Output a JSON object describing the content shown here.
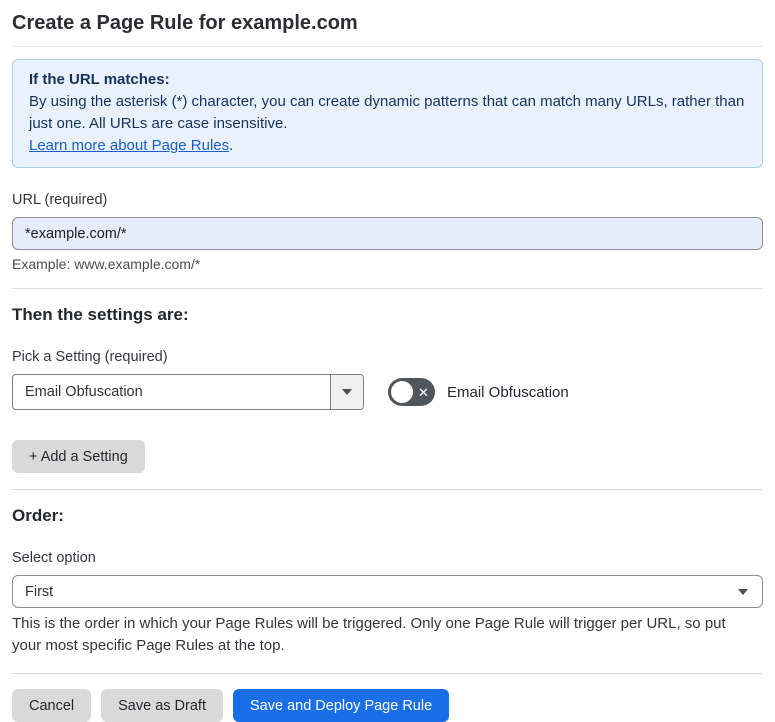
{
  "page": {
    "title": "Create a Page Rule for example.com"
  },
  "callout": {
    "heading": "If the URL matches:",
    "body": "By using the asterisk (*) character, you can create dynamic patterns that can match many URLs, rather than just one. All URLs are case insensitive.",
    "link": "Learn more about Page Rules",
    "link_suffix": "."
  },
  "url_field": {
    "label": "URL (required)",
    "value": "*example.com/*",
    "example": "Example: www.example.com/*"
  },
  "settings_section": {
    "heading": "Then the settings are:",
    "picker_label": "Pick a Setting (required)",
    "picker_value": "Email Obfuscation",
    "toggle_state": "off",
    "toggle_label": "Email Obfuscation",
    "add_setting_label": "+ Add a Setting"
  },
  "order_section": {
    "heading": "Order:",
    "select_label": "Select option",
    "select_value": "First",
    "description": "This is the order in which your Page Rules will be triggered. Only one Page Rule will trigger per URL, so put your most specific Page Rules at the top."
  },
  "footer": {
    "cancel_label": "Cancel",
    "save_draft_label": "Save as Draft",
    "save_deploy_label": "Save and Deploy Page Rule"
  },
  "icons": {
    "picker_arrow": "chevron-down-icon",
    "order_arrow": "chevron-down-icon",
    "toggle_x": "x-icon"
  },
  "colors": {
    "accent_blue": "#1a6ee8",
    "callout_bg": "#e9f2fc",
    "callout_border": "#abceec",
    "callout_text": "#16325c",
    "link_blue": "#1b5fc4",
    "input_bg": "#e5ecfb",
    "toggle_off_bg": "#4f565c",
    "gray_button_bg": "#d9d9d9"
  }
}
